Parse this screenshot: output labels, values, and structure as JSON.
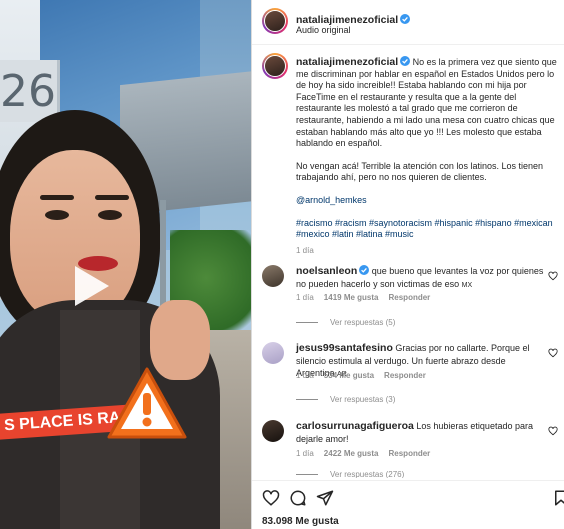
{
  "post": {
    "author": "nataliajimenezoficial",
    "audio": "Audio original",
    "caption_p1": "No es la primera vez que siento que me discriminan por hablar en español en Estados Unidos pero lo de hoy ha sido increible!! Estaba hablando con mi hija por FaceTime en el restaurante y resulta que a la gente del restaurante les molestó a tal grado que me corrieron de restaurante, habiendo a mi lado una mesa con cuatro chicas que estaban hablando más alto que yo !!! Les molesto que estaba hablando en español.",
    "caption_p2": "No vengan acá! Terrible la atención con los latinos. Los tienen trabajando ahí, pero no nos quieren de clientes.",
    "mention": "@arnold_hemkes",
    "hashtags": "#racismo #racism #saynotoracism #hispanic #hispano #mexican #mexico #latin #latina #music",
    "time": "1 día",
    "likes": "83.098 Me gusta"
  },
  "video": {
    "sign_number": "26",
    "sticker_text": "S PLACE IS RACIST"
  },
  "comments": [
    {
      "user": "noelsanleon",
      "text": "que bueno que levantes la voz por quienes no pueden hacerlo y son victimas de eso",
      "flag": "MX",
      "time": "1 día",
      "likes": "1419 Me gusta",
      "reply_label": "Responder",
      "replies": "Ver respuestas (5)"
    },
    {
      "user": "jesus99santafesino",
      "text": "Gracias por no callarte. Porque el silencio estimula al verdugo. Un fuerte abrazo desde Argentina",
      "flag": "AR",
      "time": "1 día",
      "likes": "534 Me gusta",
      "reply_label": "Responder",
      "replies": "Ver respuestas (3)"
    },
    {
      "user": "carlosurrunagafigueroa",
      "text": "Los hubieras etiquetado para dejarle amor!",
      "time": "1 día",
      "likes": "2422 Me gusta",
      "reply_label": "Responder",
      "replies": "Ver respuestas (276)"
    }
  ],
  "icons": {
    "like": "heart-icon",
    "comment": "comment-icon",
    "share": "share-icon",
    "save": "bookmark-icon",
    "verified": "verified-badge-icon",
    "play": "play-icon",
    "warning": "warning-icon"
  },
  "colors": {
    "link": "#00376b",
    "verified": "#3897f0",
    "muted": "#8e8e8e",
    "warning": "#f2701c"
  }
}
